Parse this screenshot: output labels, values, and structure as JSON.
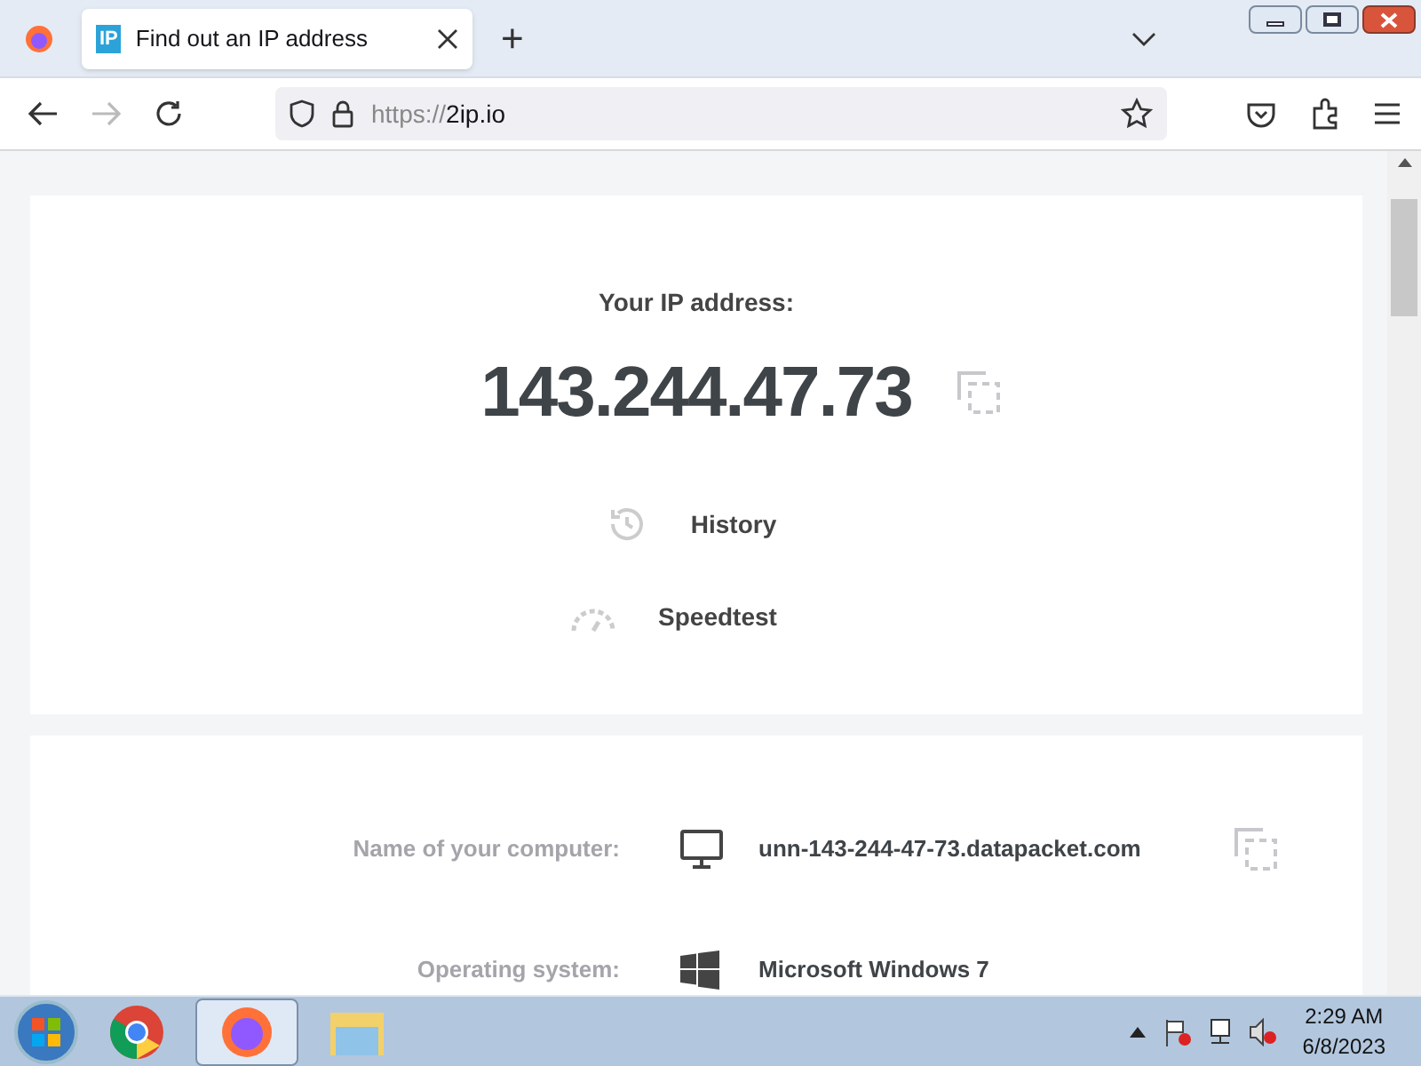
{
  "browser": {
    "tabs": [
      {
        "title": "Find out an IP address",
        "favicon": "IP",
        "selected": true
      }
    ],
    "new_tab": "+",
    "address_bar": {
      "scheme": "https://",
      "host": "2ip.io"
    }
  },
  "ip_card": {
    "heading": "Your IP address:",
    "ip": "143.244.47.73",
    "links": [
      {
        "kind": "history",
        "label": "History"
      },
      {
        "kind": "speedtest",
        "label": "Speedtest"
      }
    ]
  },
  "details": [
    {
      "kind": "computer",
      "label": "Name of your computer:",
      "value": "unn-143-244-47-73.datapacket.com",
      "copy": true
    },
    {
      "kind": "os",
      "label": "Operating system:",
      "value": "Microsoft Windows 7",
      "copy": false
    }
  ],
  "taskbar": {
    "time": "2:29 AM",
    "date": "6/8/2023",
    "apps": [
      {
        "kind": "chrome",
        "selected": false
      },
      {
        "kind": "firefox",
        "selected": true
      },
      {
        "kind": "explorer",
        "selected": false
      }
    ]
  }
}
